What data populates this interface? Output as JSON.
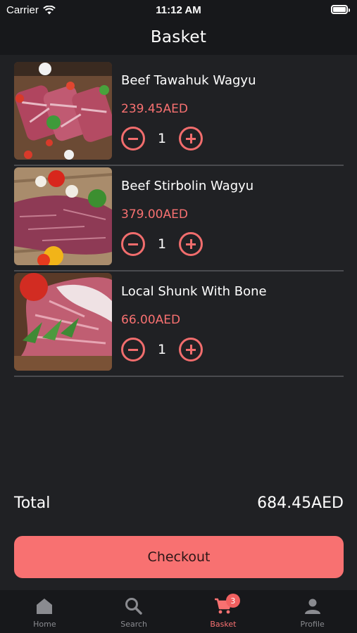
{
  "status_bar": {
    "carrier": "Carrier",
    "time": "11:12 AM"
  },
  "header": {
    "title": "Basket"
  },
  "items": [
    {
      "name": "Beef Tawahuk Wagyu",
      "price": "239.45AED",
      "quantity": "1",
      "image": "sliced-wagyu-steaks"
    },
    {
      "name": "Beef Stirbolin Wagyu",
      "price": "379.00AED",
      "quantity": "1",
      "image": "wagyu-tenderloin"
    },
    {
      "name": "Local Shunk With Bone",
      "price": "66.00AED",
      "quantity": "1",
      "image": "lamb-shank"
    }
  ],
  "total": {
    "label": "Total",
    "value": "684.45AED"
  },
  "checkout_label": "Checkout",
  "tabs": [
    {
      "label": "Home",
      "icon": "home-icon"
    },
    {
      "label": "Search",
      "icon": "search-icon"
    },
    {
      "label": "Basket",
      "icon": "cart-icon",
      "badge": "3",
      "active": true
    },
    {
      "label": "Profile",
      "icon": "person-icon"
    }
  ],
  "colors": {
    "accent": "#f87171",
    "background": "#202124",
    "bar": "#17181b",
    "inactive": "#8a8b90"
  }
}
